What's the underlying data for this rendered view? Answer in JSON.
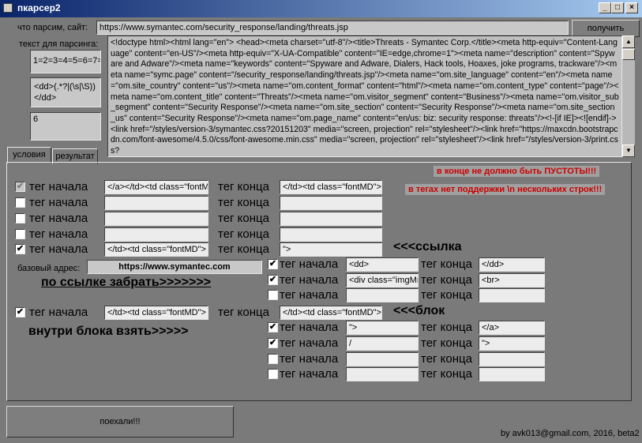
{
  "window": {
    "title": "пкарсер2",
    "controls": {
      "minimize": "_",
      "maximize": "□",
      "close": "×"
    }
  },
  "site": {
    "label": "что парсим, сайт:",
    "url": "https://www.symantec.com/security_response/landing/threats.jsp",
    "get_button": "получить"
  },
  "parse": {
    "label": "текст для парсинга:",
    "field1": "1=2=3=4=5=6=7=",
    "field2": "<dd>(.*?|(\\s|\\S))\n</dd>",
    "field3": "6",
    "html": "<!doctype html><html lang=\"en\">          <head><meta charset=\"utf-8\"/><title>Threats - Symantec Corp.</title><meta http-equiv=\"Content-Language\" content=\"en-US\"/><meta http-equiv=\"X-UA-Compatible\" content=\"IE=edge,chrome=1\"><meta name=\"description\" content=\"Spyware and Adware\"/><meta name=\"keywords\" content=\"Spyware and Adware, Dialers, Hack tools, Hoaxes, joke programs, trackware\"/><meta name=\"symc.page\" content=\"/security_response/landing/threats.jsp\"/><meta name=\"om.site_language\" content=\"en\"/><meta name=\"om.site_country\" content=\"us\"/><meta name=\"om.content_format\" content=\"html\"/><meta name=\"om.content_type\" content=\"page\"/><meta name=\"om.content_title\" content=\"Threats\"/><meta name=\"om.visitor_segment\" content=\"Business\"/><meta name=\"om.visitor_sub_segment\" content=\"Security Response\"/><meta name=\"om.site_section\" content=\"Security Response\"/><meta name=\"om.site_section_us\" content=\"Security Response\"/><meta name=\"om.page_name\" content=\"en/us: biz: security response: threats\"/><!-[if IE]><![endif]-><link href=\"/styles/version-3/symantec.css?20151203\" media=\"screen, projection\" rel=\"stylesheet\"/><link href=\"https://maxcdn.bootstrapcdn.com/font-awesome/4.5.0/css/font-awesome.min.css\" media=\"screen, projection\" rel=\"stylesheet\"/><link href=\"/styles/version-3/print.css?"
  },
  "tabs": {
    "conditions": "условия",
    "result": "результат"
  },
  "warnings": {
    "no_empty": "в конце не должно быть ПУСТОТЫ!!!",
    "no_multiline": "в тегах нет поддержки \\n нескольких строк!!!"
  },
  "labels": {
    "tag_start": "тег начала",
    "tag_end": "тег конца",
    "link_hint": "<<<ссылка",
    "block_hint": "<<<блок",
    "base_address": "базовый адрес:",
    "by_link_take": "по ссылке забрать>>>>>>>",
    "inside_block_take": "внутри блока взять>>>>>"
  },
  "rows_main": [
    {
      "checked": true,
      "disabled": true,
      "start": "</a></td><td class=\"fontM",
      "end": "</td><td class=\"fontMD\">"
    },
    {
      "checked": false,
      "disabled": false,
      "start": "",
      "end": ""
    },
    {
      "checked": false,
      "disabled": false,
      "start": "",
      "end": ""
    },
    {
      "checked": false,
      "disabled": false,
      "start": "",
      "end": ""
    },
    {
      "checked": true,
      "disabled": false,
      "start": "</td><td class=\"fontMD\">",
      "end": "\">"
    }
  ],
  "base_url": "https://www.symantec.com",
  "rows_link": [
    {
      "checked": true,
      "start": "<dd>",
      "end": "</dd>"
    },
    {
      "checked": true,
      "start": "<div class=\"imgMr",
      "end": "<br>"
    },
    {
      "checked": false,
      "start": "",
      "end": ""
    }
  ],
  "row_block": {
    "checked": true,
    "start": "</td><td class=\"fontMD\">",
    "end": "</td><td class=\"fontMD\">"
  },
  "rows_inside": [
    {
      "checked": true,
      "start": "\">",
      "end": "</a>"
    },
    {
      "checked": true,
      "start": "/",
      "end": "\">"
    },
    {
      "checked": false,
      "start": "",
      "end": ""
    },
    {
      "checked": false,
      "start": "",
      "end": ""
    }
  ],
  "go_button": "поехали!!!",
  "footer": "by avk013@gmail.com, 2016, beta2"
}
